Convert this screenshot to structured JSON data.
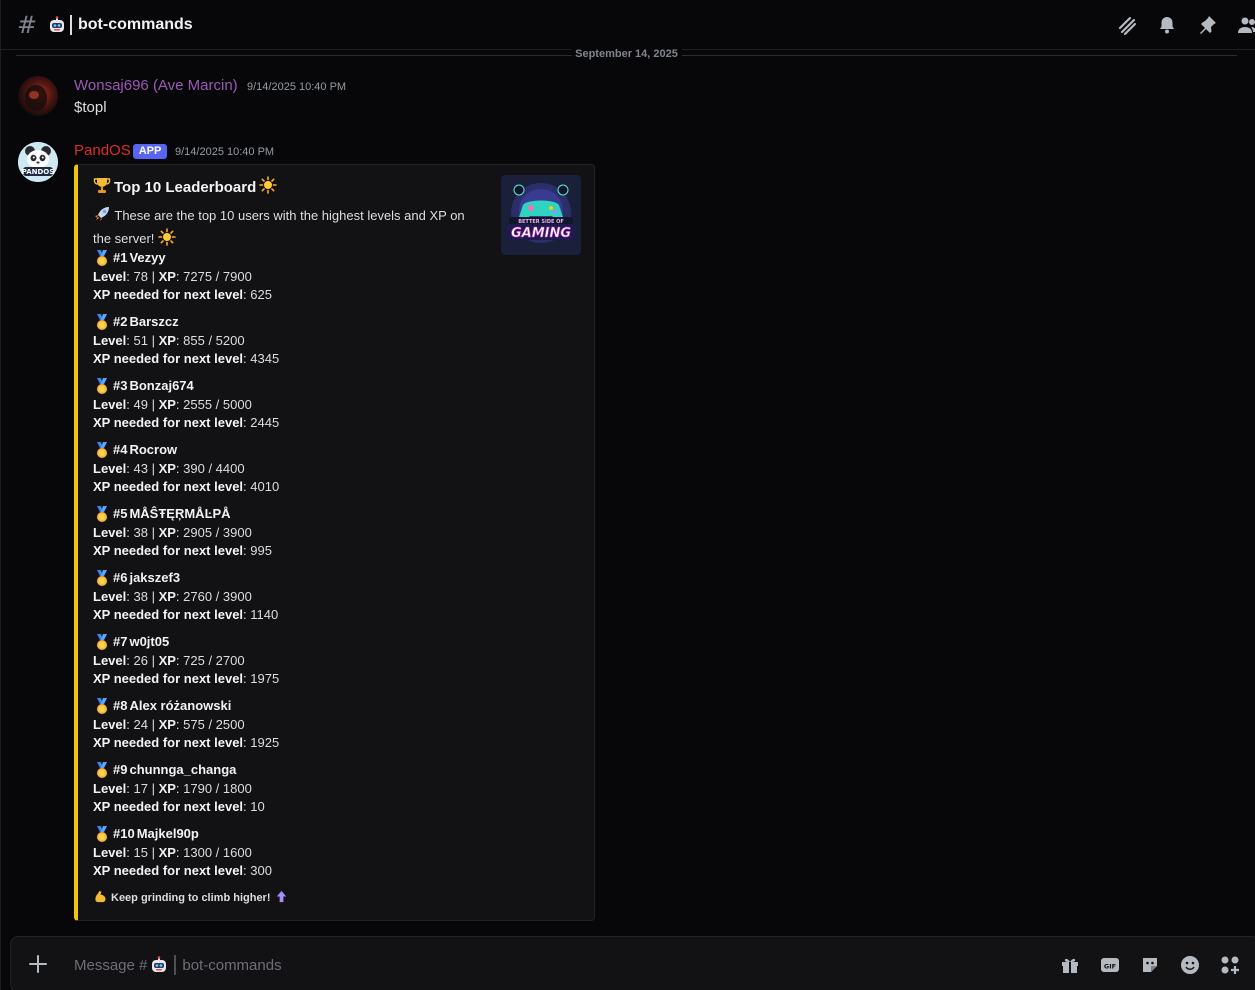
{
  "channel": {
    "name": "bot-commands",
    "hash_icon": "#"
  },
  "header_icons": [
    "threads-icon",
    "bell-icon",
    "pin-icon",
    "members-icon"
  ],
  "date_divider": "September 14, 2025",
  "messages": [
    {
      "author": "Wonsaj696 (Ave Marcin)",
      "author_color": "#9b59b6",
      "timestamp": "9/14/2025 10:40 PM",
      "content": "$topl"
    },
    {
      "author": "PandOS",
      "author_color": "#e02b2b",
      "badge": "APP",
      "timestamp": "9/14/2025 10:40 PM",
      "avatar_text": "PANDOS",
      "embed": {
        "accent_color": "#f1c40f",
        "title": "Top 10 Leaderboard",
        "description": "These are the top 10 users with the highest levels and XP on the server!",
        "thumbnail": {
          "top_text": "BETTER SIDE OF",
          "main_text": "GAMING"
        },
        "labels": {
          "level": "Level",
          "xp": "XP",
          "needed": "XP needed for next level"
        },
        "entries": [
          {
            "rank": "#1",
            "name": "Vezyy",
            "level": "78",
            "xp": "7275 / 7900",
            "needed": "625"
          },
          {
            "rank": "#2",
            "name": "Barszcz",
            "level": "51",
            "xp": "855 / 5200",
            "needed": "4345"
          },
          {
            "rank": "#3",
            "name": "Bonzaj674",
            "level": "49",
            "xp": "2555 / 5000",
            "needed": "2445"
          },
          {
            "rank": "#4",
            "name": "Rocrow",
            "level": "43",
            "xp": "390 / 4400",
            "needed": "4010"
          },
          {
            "rank": "#5",
            "name": "MÅŜŦĘŖMÅĿPÅ",
            "level": "38",
            "xp": "2905 / 3900",
            "needed": "995"
          },
          {
            "rank": "#6",
            "name": "jakszef3",
            "level": "38",
            "xp": "2760 / 3900",
            "needed": "1140"
          },
          {
            "rank": "#7",
            "name": "w0jt05",
            "level": "26",
            "xp": "725 / 2700",
            "needed": "1975"
          },
          {
            "rank": "#8",
            "name": "Alex różanowski",
            "level": "24",
            "xp": "575 / 2500",
            "needed": "1925"
          },
          {
            "rank": "#9",
            "name": "chunnga_changa",
            "level": "17",
            "xp": "1790 / 1800",
            "needed": "10"
          },
          {
            "rank": "#10",
            "name": "Majkel90p",
            "level": "15",
            "xp": "1300 / 1600",
            "needed": "300"
          }
        ],
        "footer": "Keep grinding to climb higher!"
      }
    }
  ],
  "composer": {
    "placeholder_prefix": "Message #",
    "placeholder_channel": "bot-commands",
    "gif_label": "GIF",
    "icons": [
      "gift-icon",
      "gif-icon",
      "sticker-icon",
      "emoji-icon",
      "apps-icon"
    ]
  }
}
